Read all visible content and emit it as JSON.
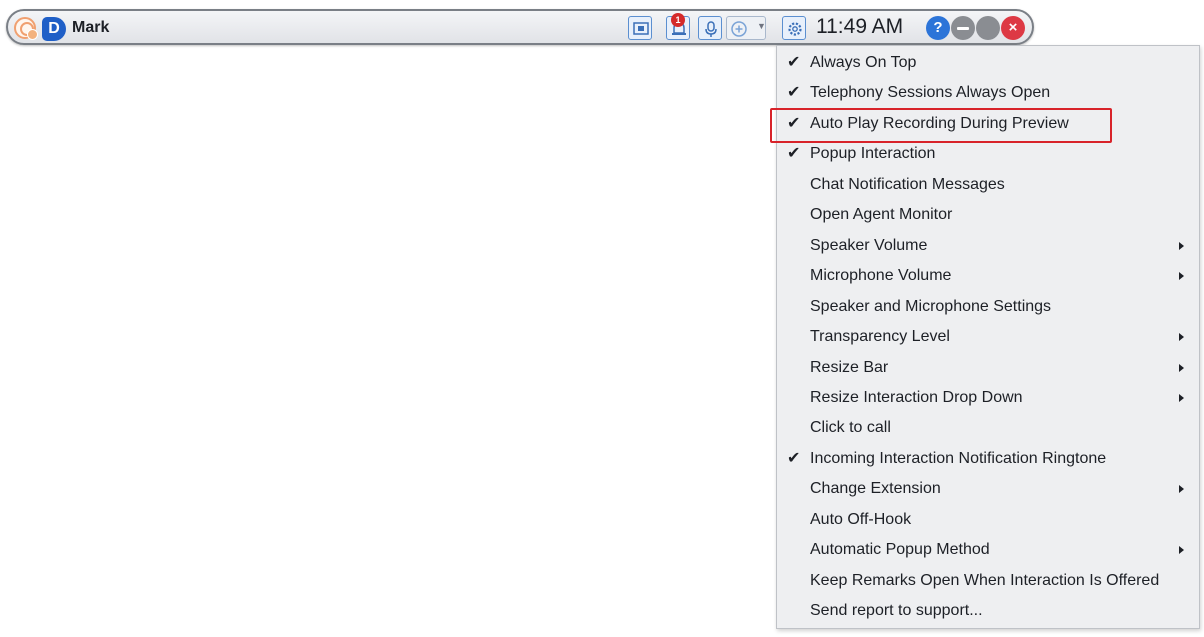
{
  "agent_bar": {
    "agent_name": "Mark",
    "brand_letter": "D",
    "notification_count": "1",
    "clock": "11:49 AM",
    "help_label": "?",
    "close_label": "×"
  },
  "icons": {
    "avatar": "agent-avatar-icon",
    "brand": "brand-logo-icon",
    "interaction": "interaction-window-icon",
    "notifications": "notification-bell-icon",
    "microphone": "microphone-icon",
    "add": "add-circle-icon",
    "settings": "gear-icon",
    "help": "help-icon",
    "minimize": "minimize-icon",
    "maximize": "maximize-icon",
    "close": "close-icon"
  },
  "colors": {
    "accent": "#2c74d8",
    "notification_badge": "#d42a2a",
    "close_button": "#dd3944",
    "highlight_border": "#d8232a"
  },
  "settings_menu": {
    "items": [
      {
        "label": "Always On Top",
        "checked": true,
        "submenu": false
      },
      {
        "label": "Telephony Sessions Always Open",
        "checked": true,
        "submenu": false
      },
      {
        "label": "Auto Play Recording During Preview",
        "checked": true,
        "submenu": false,
        "highlighted": true
      },
      {
        "label": "Popup Interaction",
        "checked": true,
        "submenu": false
      },
      {
        "label": "Chat Notification Messages",
        "checked": false,
        "submenu": false
      },
      {
        "label": "Open Agent Monitor",
        "checked": false,
        "submenu": false
      },
      {
        "label": "Speaker Volume",
        "checked": false,
        "submenu": true
      },
      {
        "label": "Microphone Volume",
        "checked": false,
        "submenu": true
      },
      {
        "label": "Speaker and Microphone Settings",
        "checked": false,
        "submenu": false
      },
      {
        "label": "Transparency Level",
        "checked": false,
        "submenu": true
      },
      {
        "label": "Resize Bar",
        "checked": false,
        "submenu": true
      },
      {
        "label": "Resize Interaction Drop Down",
        "checked": false,
        "submenu": true
      },
      {
        "label": "Click to call",
        "checked": false,
        "submenu": false
      },
      {
        "label": "Incoming Interaction Notification Ringtone",
        "checked": true,
        "submenu": false
      },
      {
        "label": "Change Extension",
        "checked": false,
        "submenu": true
      },
      {
        "label": "Auto Off-Hook",
        "checked": false,
        "submenu": false
      },
      {
        "label": "Automatic Popup Method",
        "checked": false,
        "submenu": true
      },
      {
        "label": "Keep Remarks Open When Interaction Is Offered",
        "checked": false,
        "submenu": false
      },
      {
        "label": "Send report to support...",
        "checked": false,
        "submenu": false
      }
    ]
  }
}
